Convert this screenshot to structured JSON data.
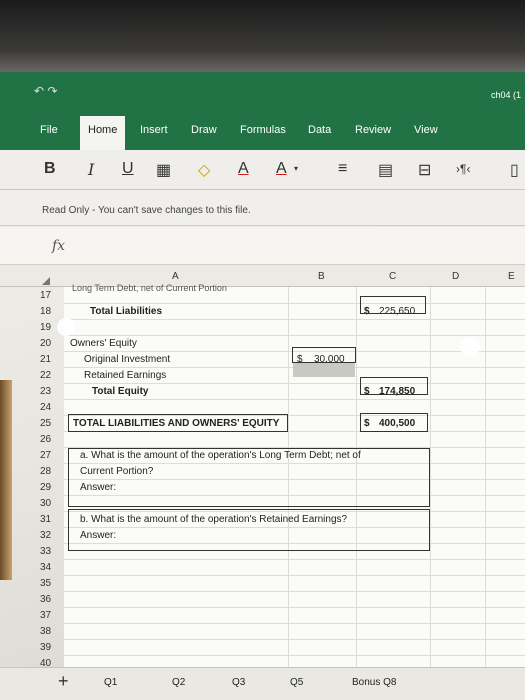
{
  "window": {
    "title": "ch04 (1"
  },
  "ribbon": {
    "tabs": [
      "File",
      "Home",
      "Insert",
      "Draw",
      "Formulas",
      "Data",
      "Review",
      "View"
    ],
    "active_tab": "Home",
    "tools": [
      "B",
      "I",
      "U",
      "A",
      "A"
    ]
  },
  "notice": "Read Only - You can't save changes to this file.",
  "formula_bar": {
    "label": "fx",
    "value": ""
  },
  "columns": [
    "A",
    "B",
    "C",
    "D",
    "E"
  ],
  "rows": [
    {
      "n": "17",
      "text": "Long Term Debt, net of Current Portion"
    },
    {
      "n": "18",
      "a": "Total Liabilities",
      "c_sym": "$",
      "c_val": "225,650"
    },
    {
      "n": "19"
    },
    {
      "n": "20",
      "a": "Owners' Equity"
    },
    {
      "n": "21",
      "a": "Original Investment",
      "b_sym": "$",
      "b_val": "30,000"
    },
    {
      "n": "22",
      "a": "Retained Earnings"
    },
    {
      "n": "23",
      "a": "Total Equity",
      "c_sym": "$",
      "c_val": "174,850"
    },
    {
      "n": "24"
    },
    {
      "n": "25",
      "a": "TOTAL LIABILITIES AND OWNERS' EQUITY",
      "c_sym": "$",
      "c_val": "400,500"
    },
    {
      "n": "26"
    },
    {
      "n": "27",
      "a": "a. What is the amount of the operation's Long Term Debt; net of"
    },
    {
      "n": "28",
      "a": "Current Portion?"
    },
    {
      "n": "29",
      "a": "Answer:"
    },
    {
      "n": "30"
    },
    {
      "n": "31",
      "a": "b. What is the amount of the operation's Retained Earnings?"
    },
    {
      "n": "32",
      "a": "Answer:"
    },
    {
      "n": "33"
    },
    {
      "n": "34"
    },
    {
      "n": "35"
    },
    {
      "n": "36"
    },
    {
      "n": "37"
    },
    {
      "n": "38"
    },
    {
      "n": "39"
    },
    {
      "n": "40"
    }
  ],
  "sheets": [
    "Q1",
    "Q2",
    "Q3",
    "Q5",
    "Bonus Q8"
  ],
  "add_sheet": "+"
}
